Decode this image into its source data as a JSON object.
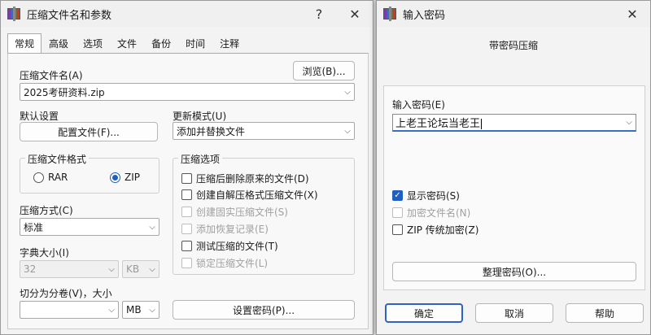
{
  "main_window": {
    "title": "压缩文件名和参数",
    "help_glyph": "?",
    "close_glyph": "✕",
    "tabs": [
      "常规",
      "高级",
      "选项",
      "文件",
      "备份",
      "时间",
      "注释"
    ],
    "archive_name_label": "压缩文件名(A)",
    "browse_button": "浏览(B)...",
    "archive_name_value": "2025考研资料.zip",
    "default_settings_label": "默认设置",
    "profiles_button": "配置文件(F)...",
    "update_mode_label": "更新模式(U)",
    "update_mode_value": "添加并替换文件",
    "format_group_title": "压缩文件格式",
    "format_rar": "RAR",
    "format_zip": "ZIP",
    "options_group_title": "压缩选项",
    "options": [
      {
        "label": "压缩后删除原来的文件(D)",
        "checked": false,
        "enabled": true
      },
      {
        "label": "创建自解压格式压缩文件(X)",
        "checked": false,
        "enabled": true
      },
      {
        "label": "创建固实压缩文件(S)",
        "checked": false,
        "enabled": false
      },
      {
        "label": "添加恢复记录(E)",
        "checked": false,
        "enabled": false
      },
      {
        "label": "测试压缩的文件(T)",
        "checked": false,
        "enabled": true
      },
      {
        "label": "锁定压缩文件(L)",
        "checked": false,
        "enabled": false
      }
    ],
    "method_label": "压缩方式(C)",
    "method_value": "标准",
    "dict_label": "字典大小(I)",
    "dict_value": "32",
    "dict_unit": "KB",
    "split_label": "切分为分卷(V)，大小",
    "split_value": "",
    "split_unit": "MB",
    "set_password_button": "设置密码(P)..."
  },
  "password_window": {
    "title": "输入密码",
    "close_glyph": "✕",
    "subtitle": "带密码压缩",
    "enter_password_label": "输入密码(E)",
    "password_value": "上老王论坛当老王",
    "show_password": {
      "label": "显示密码(S)",
      "checked": true
    },
    "encrypt_names": {
      "label": "加密文件名(N)",
      "checked": false
    },
    "zip_legacy": {
      "label": "ZIP 传统加密(Z)",
      "checked": false
    },
    "organize_button": "整理密码(O)...",
    "ok_button": "确定",
    "cancel_button": "取消",
    "help_button": "帮助"
  },
  "colors": {
    "accent": "#1f5fbf"
  }
}
